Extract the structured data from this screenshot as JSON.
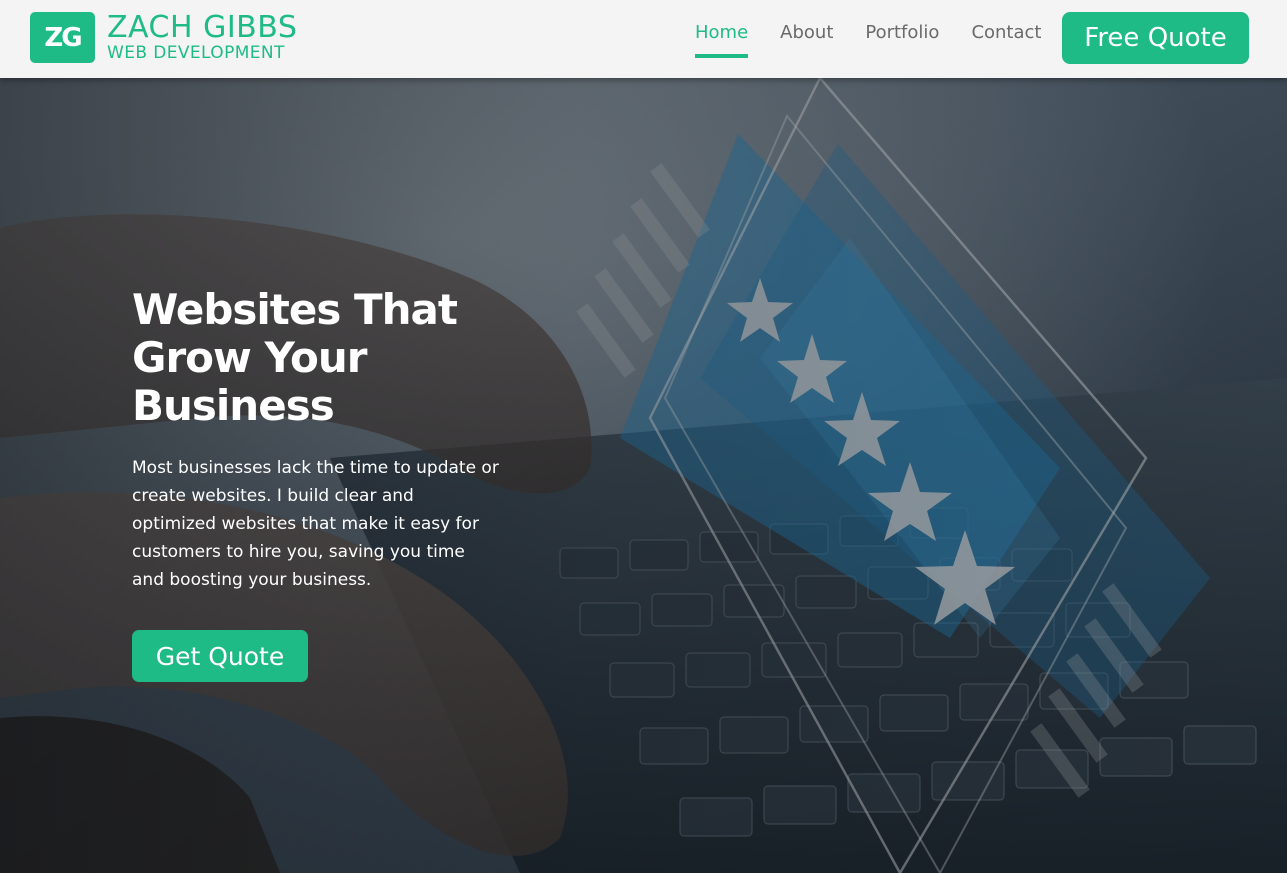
{
  "header": {
    "logo_mark": "ZG",
    "logo_name": "ZACH GIBBS",
    "logo_tagline": "WEB DEVELOPMENT",
    "nav": [
      {
        "label": "Home",
        "active": true
      },
      {
        "label": "About",
        "active": false
      },
      {
        "label": "Portfolio",
        "active": false
      },
      {
        "label": "Contact",
        "active": false
      }
    ],
    "cta_label": "Free Quote"
  },
  "hero": {
    "title_lines": [
      "Websites That",
      "Grow Your",
      "Business"
    ],
    "description": "Most businesses lack the time to update or create websites. I build clear and optimized websites that make it easy for customers to hire you, saving you time and boosting your business.",
    "cta_label": "Get Quote"
  },
  "colors": {
    "accent": "#1fbb86",
    "header_bg": "#f4f4f4",
    "nav_text": "#6a6a6a",
    "hero_text": "#ffffff"
  }
}
